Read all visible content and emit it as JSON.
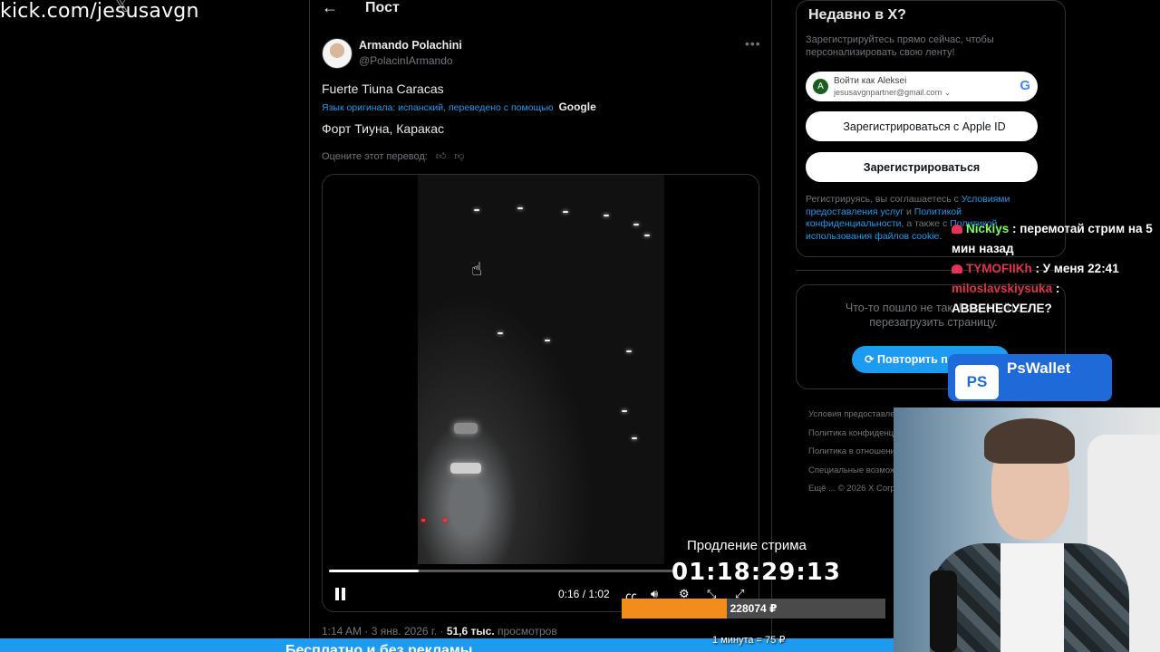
{
  "stream": {
    "watermark": "kick.com/jesusavgn",
    "subathon_label": "Продление стрима",
    "subathon_timer": "01:18:29:13",
    "subathon_amount": "228074 ₽",
    "subathon_progress": 0.4,
    "subathon_rate": "1 минута = 75 ₽",
    "sponsor_name": "PsWallet",
    "sponsor_logo_text": "PS"
  },
  "chat": [
    {
      "user": "Nickiys",
      "color": "#7cff5a",
      "message": "перемотай стрим на 5 мин назад"
    },
    {
      "user": "TYMOFIIKh",
      "color": "#e0344a",
      "message": "У меня 22:41"
    },
    {
      "user": "miloslavskiysuka",
      "color": "#e0344a",
      "message": "АВВЕНЕСУЕЛЕ?"
    }
  ],
  "header": {
    "back_icon": "arrow-left-icon",
    "title": "Пост"
  },
  "post": {
    "author_name": "Armando Polachini",
    "author_handle": "@PolacinIArmando",
    "text": "Fuerte Tiuna Caracas",
    "translation_note": "Язык оригинала: испанский, переведено с помощью",
    "translation_provider": "Google",
    "translated_text": "Форт Тиуна, Каракас",
    "rate_prompt": "Оцените этот перевод:",
    "timestamp": "1:14 AM · 3 янв. 2026 г. ·",
    "views_count": "51,6 тыс.",
    "views_label": "просмотров"
  },
  "video": {
    "current_time": "0:16",
    "duration": "1:02",
    "time_display": "0:16 / 1:02",
    "progress": 0.26,
    "controls": [
      "cc-icon",
      "volume-icon",
      "settings-icon",
      "minimize-icon",
      "fullscreen-icon"
    ]
  },
  "sidebar": {
    "signup_title": "Недавно в X?",
    "signup_subtitle": "Зарегистрируйтесь прямо сейчас, чтобы персонализировать свою ленту!",
    "google_signin_name": "Войти как Aleksei",
    "google_signin_email": "jesusavgnpartner@gmail.com",
    "google_avatar_letter": "A",
    "apple_button": "Зарегистрироваться с Apple ID",
    "signup_button": "Зарегистрироваться",
    "legal_prefix": "Регистрируясь, вы соглашаетесь с",
    "legal_terms": "Условиями предоставления услуг",
    "legal_and": "и",
    "legal_privacy": "Политикой конфиденциальности",
    "legal_also": ", а также с",
    "legal_cookies": "Политикой использования файлов cookie.",
    "error_text": "Что-то пошло не так. Попробуйте перезагрузить страницу.",
    "retry_button": "Повторить попытку",
    "footer_links": [
      "Условия предоставления услуг",
      "Политика конфиденциальности",
      "Политика в отношении файлов cookie",
      "Специальные возможности",
      "Ещё ...  © 2026 X Corp."
    ]
  },
  "bottom_bar_text": "Бесплатно и без рекламы"
}
